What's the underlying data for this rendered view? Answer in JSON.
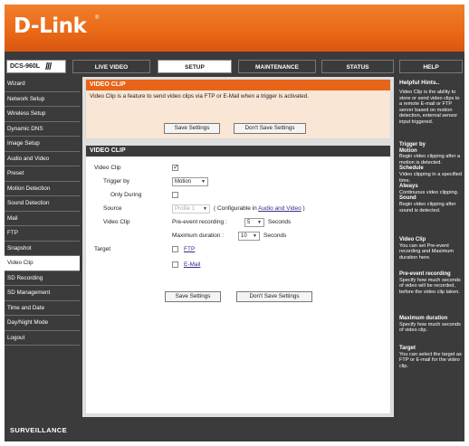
{
  "brand": {
    "logo": "D-Link",
    "registered": "®"
  },
  "model": {
    "name": "DCS-960L",
    "slashes": "///"
  },
  "tabs": [
    {
      "label": "LIVE VIDEO"
    },
    {
      "label": "SETUP"
    },
    {
      "label": "MAINTENANCE"
    },
    {
      "label": "STATUS"
    },
    {
      "label": "HELP"
    }
  ],
  "sidebar": {
    "items": [
      {
        "label": "Wizard"
      },
      {
        "label": "Network Setup"
      },
      {
        "label": "Wireless Setup"
      },
      {
        "label": "Dynamic DNS"
      },
      {
        "label": "Image Setup"
      },
      {
        "label": "Audio and Video"
      },
      {
        "label": "Preset"
      },
      {
        "label": "Motion Detection"
      },
      {
        "label": "Sound Detection"
      },
      {
        "label": "Mail"
      },
      {
        "label": "FTP"
      },
      {
        "label": "Snapshot"
      },
      {
        "label": "Video Clip"
      },
      {
        "label": "SD Recording"
      },
      {
        "label": "SD Management"
      },
      {
        "label": "Time and Date"
      },
      {
        "label": "Day/Night Mode"
      },
      {
        "label": "Logout"
      }
    ],
    "active": "Video Clip"
  },
  "intro": {
    "title": "VIDEO CLIP",
    "text": "Video Clip is a feature to send video clips via FTP or E-Mail when a trigger is activated.",
    "save_label": "Save Settings",
    "dont_save_label": "Don't Save Settings"
  },
  "form": {
    "title": "VIDEO CLIP",
    "video_clip_label": "Video Clip",
    "video_clip_enabled": true,
    "trigger_label": "Trigger by",
    "trigger_value": "Motion",
    "only_during_label": "Only During",
    "only_during_checked": false,
    "source_label": "Source",
    "source_value": "Profile 1",
    "source_note_pre": "( Configurable in ",
    "source_note_link": "Audio and Video",
    "source_note_post": " )",
    "clip_label": "Video Clip",
    "pre_event_label": "Pre-event recording :",
    "pre_event_value": "5",
    "seconds_1": "Seconds",
    "max_duration_label": "Maximum duration :",
    "max_duration_value": "10",
    "seconds_2": "Seconds",
    "target_label": "Target",
    "ftp_label": "FTP",
    "ftp_checked": false,
    "email_label": "E-Mail",
    "email_checked": false,
    "save_label": "Save Settings",
    "dont_save_label": "Don't Save Settings"
  },
  "help": {
    "title": "Helpful Hints..",
    "intro": "Video Clip is the ability to store or send video clips to a remote E-mail or FTP server based on motion detection, external sensor input triggered.",
    "trigger_title": "Trigger by",
    "motion_title": "Motion",
    "motion_text": "Begin video clipping after a motion is detected.",
    "schedule_title": "Schedule",
    "schedule_text": "Video clipping in a specified time.",
    "always_title": "Always",
    "always_text": "Continuous video clipping.",
    "sound_title": "Sound",
    "sound_text": "Begin video clipping after sound is detected.",
    "clip_title": "Video Clip",
    "clip_text": "You can set Pre-event recording and Maximum duration here.",
    "pre_title": "Pre-event recording",
    "pre_text": "Specify how much seconds of video will be recorded, before the video clip taken.",
    "max_title": "Maximum duration",
    "max_text": "Specify how much seconds of video clip.",
    "target_title": "Target",
    "target_text": "You can select the target as FTP or E-mail for the video clip."
  },
  "footer": {
    "text": "SURVEILLANCE"
  }
}
